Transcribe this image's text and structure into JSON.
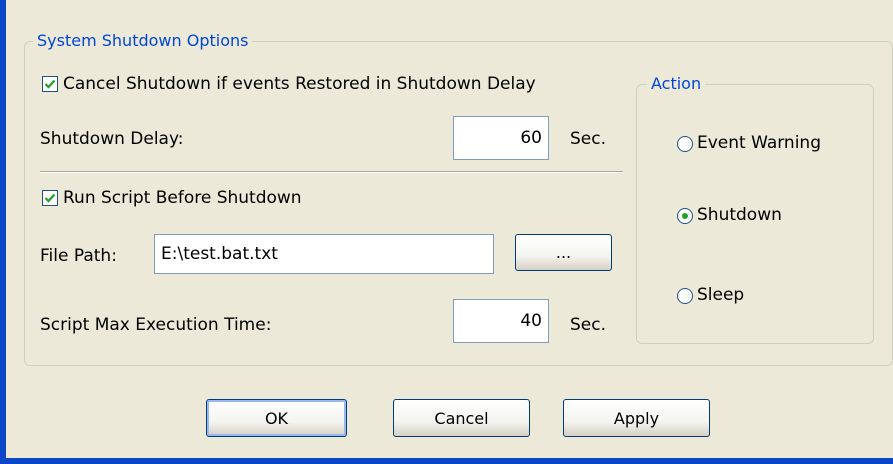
{
  "shutdown_options": {
    "legend": "System Shutdown Options",
    "cancel_shutdown": {
      "label": "Cancel Shutdown if events Restored in Shutdown Delay",
      "checked": true
    },
    "shutdown_delay": {
      "label": "Shutdown Delay:",
      "value": "60",
      "unit": "Sec."
    },
    "run_script": {
      "label": "Run Script Before Shutdown",
      "checked": true
    },
    "file_path": {
      "label": "File Path:",
      "value": "E:\\test.bat.txt",
      "browse_label": "..."
    },
    "max_exec_time": {
      "label": "Script Max Execution Time:",
      "value": "40",
      "unit": "Sec."
    }
  },
  "action": {
    "legend": "Action",
    "options": [
      {
        "label": "Event Warning",
        "selected": false
      },
      {
        "label": "Shutdown",
        "selected": true
      },
      {
        "label": "Sleep",
        "selected": false
      }
    ]
  },
  "buttons": {
    "ok": "OK",
    "cancel": "Cancel",
    "apply": "Apply"
  },
  "colors": {
    "legend_text": "#0046d5",
    "window_border": "#0a46c8",
    "check_mark": "#21a121"
  }
}
